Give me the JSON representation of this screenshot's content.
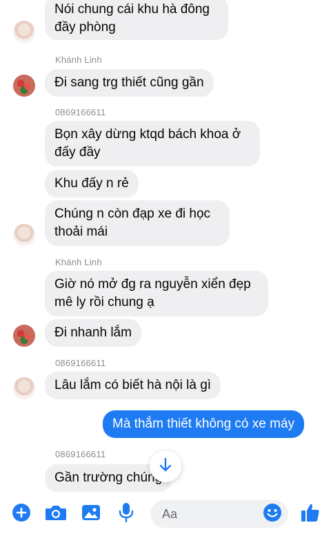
{
  "colors": {
    "accent": "#1e7bf2",
    "bubble_in": "#efeff1",
    "meta_text": "#8a8d91"
  },
  "messages": [
    {
      "text": "Nói chung cái khu hà đông\nđầy phòng"
    },
    {
      "sender": "Khánh Linh",
      "text": "Đi sang trg thiết cũng gần"
    },
    {
      "sender": "0869166611",
      "text": "Bọn xây dừng ktqd bách khoa ở\nđấy đầy"
    },
    {
      "text": "Khu đấy n rẻ"
    },
    {
      "text": "Chúng n còn đạp xe đi học\nthoải mái"
    },
    {
      "sender": "Khánh Linh",
      "text": "Giờ nó mở đg ra nguyễn xiển đẹp\nmê ly rồi chung ạ"
    },
    {
      "text": "Đi nhanh lắm"
    },
    {
      "sender": "0869166611",
      "text": "Lâu lắm có biết hà nội là gì"
    },
    {
      "text": "Mà thắm thiết không có xe máy"
    },
    {
      "sender": "0869166611",
      "text": "Gần trường chúng"
    }
  ],
  "composer": {
    "placeholder": "Aa",
    "icons": [
      "plus-icon",
      "camera-icon",
      "photo-icon",
      "microphone-icon",
      "emoji-icon",
      "like-icon"
    ]
  },
  "scroll_button_icon": "arrow-down-icon"
}
